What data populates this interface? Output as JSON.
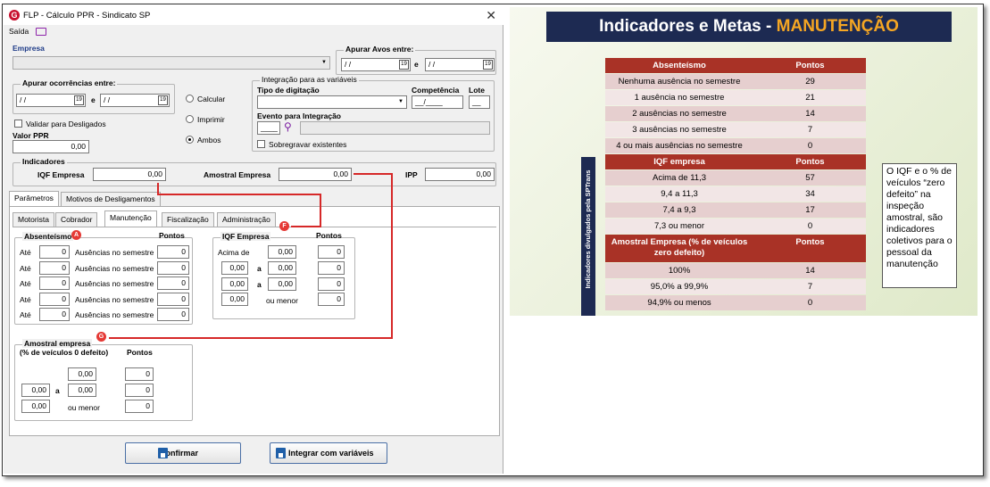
{
  "window": {
    "title": "FLP - Cálculo PPR - Sindicato SP",
    "menu_saida": "Saída"
  },
  "empresa": {
    "label": "Empresa"
  },
  "apurar_avos": {
    "label": "Apurar Avos entre:",
    "from": "/ /",
    "e": "e",
    "to": "/ /"
  },
  "apurar_ocorrencias": {
    "label": "Apurar ocorrências entre:",
    "from": "/ /",
    "e": "e",
    "to": "/ /"
  },
  "validar_desligados": "Validar para Desligados",
  "valor_ppr": {
    "label": "Valor PPR",
    "value": "0,00"
  },
  "modo": {
    "calcular": "Calcular",
    "imprimir": "Imprimir",
    "ambos": "Ambos"
  },
  "integracao": {
    "label": "Integração para as variáveis",
    "tipo_digitacao": "Tipo de digitação",
    "competencia": "Competência",
    "competencia_value": "__/____",
    "lote": "Lote",
    "lote_value": "__",
    "evento": "Evento para Integração",
    "evento_value": "____",
    "sobregravar": "Sobregravar existentes"
  },
  "indicadores": {
    "label": "Indicadores",
    "iqf_label": "IQF Empresa",
    "iqf_value": "0,00",
    "amostral_label": "Amostral Empresa",
    "amostral_value": "0,00",
    "ipp_label": "IPP",
    "ipp_value": "0,00"
  },
  "tabs": {
    "parametros": "Parâmetros",
    "motivos": "Motivos de Desligamentos"
  },
  "subtabs": {
    "motorista": "Motorista",
    "cobrador": "Cobrador",
    "manutencao": "Manutenção",
    "fiscalizacao": "Fiscalização",
    "administracao": "Administração"
  },
  "absenteismo": {
    "label": "Absenteísmo",
    "pontos": "Pontos",
    "rows": [
      {
        "ate": "Até",
        "value": "0",
        "desc": "Ausências no semestre",
        "pontos": "0"
      },
      {
        "ate": "Até",
        "value": "0",
        "desc": "Ausências no semestre",
        "pontos": "0"
      },
      {
        "ate": "Até",
        "value": "0",
        "desc": "Ausências no semestre",
        "pontos": "0"
      },
      {
        "ate": "Até",
        "value": "0",
        "desc": "Ausências no semestre",
        "pontos": "0"
      },
      {
        "ate": "Até",
        "value": "0",
        "desc": "Ausências no semestre",
        "pontos": "0"
      }
    ]
  },
  "iqf_group": {
    "label": "IQF Empresa",
    "pontos": "Pontos",
    "acima_de": "Acima de",
    "a": "a",
    "ou_menor": "ou menor",
    "v_acima": "0,00",
    "r2a": "0,00",
    "r2b": "0,00",
    "r3a": "0,00",
    "r3b": "0,00",
    "r4": "0,00",
    "p1": "0",
    "p2": "0",
    "p3": "0",
    "p4": "0"
  },
  "amostral_group": {
    "label": "Amostral empresa",
    "label2": "(% de veículos 0 defeito)",
    "pontos": "Pontos",
    "a": "a",
    "ou_menor": "ou menor",
    "v1": "0,00",
    "r2a": "0,00",
    "r2b": "0,00",
    "r3": "0,00",
    "p1": "0",
    "p2": "0",
    "p3": "0"
  },
  "markers": {
    "a": "A",
    "f": "F",
    "g": "G"
  },
  "buttons": {
    "confirmar": "Confirmar",
    "integrar": "Integrar com variáveis"
  },
  "slide": {
    "title_main": "Indicadores e Metas - ",
    "title_accent": "MANUTENÇÃO",
    "side_label": "Indicadores divulgados pela SPTrans",
    "note": "O IQF e o % de veículos “zero defeito” na inspeção amostral, são indicadores coletivos para o pessoal da manutenção",
    "absenteismo": {
      "header": [
        "Absenteísmo",
        "Pontos"
      ],
      "rows": [
        [
          "Nenhuma ausência no semestre",
          "29"
        ],
        [
          "1 ausência no semestre",
          "21"
        ],
        [
          "2 ausências no semestre",
          "14"
        ],
        [
          "3 ausências no semestre",
          "7"
        ],
        [
          "4 ou mais ausências no semestre",
          "0"
        ]
      ]
    },
    "iqf": {
      "header": [
        "IQF empresa",
        "Pontos"
      ],
      "rows": [
        [
          "Acima de 11,3",
          "57"
        ],
        [
          "9,4 a 11,3",
          "34"
        ],
        [
          "7,4 a 9,3",
          "17"
        ],
        [
          "7,3 ou menor",
          "0"
        ]
      ]
    },
    "amostral": {
      "header": [
        "Amostral Empresa (% de veículos zero defeito)",
        "Pontos"
      ],
      "rows": [
        [
          "100%",
          "14"
        ],
        [
          "95,0% a 99,9%",
          "7"
        ],
        [
          "94,9% ou menos",
          "0"
        ]
      ]
    }
  },
  "colors": {
    "title_bg": "#1d2a52",
    "accent": "#f5a623",
    "table_header": "#a93226",
    "marker": "#e53935"
  }
}
